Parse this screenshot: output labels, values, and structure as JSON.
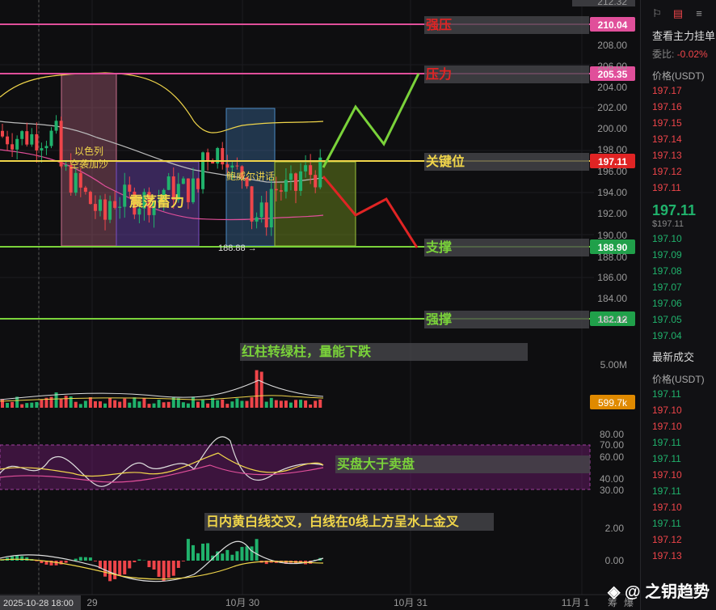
{
  "colors": {
    "bg": "#0e0e10",
    "up": "#20b26c",
    "down": "#ef454a",
    "pink": "#e04f9a",
    "yellow": "#f0d54a",
    "green": "#7ad23a",
    "red_line": "#e02424"
  },
  "price_axis": {
    "ticks": [
      "212.32",
      "208.00",
      "206.00",
      "204.00",
      "202.00",
      "200.00",
      "198.00",
      "196.00",
      "194.00",
      "192.00",
      "190.00",
      "188.00",
      "186.00",
      "184.00",
      "182.00"
    ],
    "badges": {
      "strong_resist": "210.04",
      "resist": "205.35",
      "key": "197.11",
      "support": "188.90",
      "strong_support": "182.12",
      "vol": "599.7k"
    }
  },
  "levels": {
    "strong_resist": "强压",
    "resist": "压力",
    "key": "关键位",
    "support": "支撑",
    "strong_support": "强撑"
  },
  "annotations": {
    "box1_line1": "以色列",
    "box1_line2": "空袭加沙",
    "box2": "震荡蓄力",
    "box3": "鲍威尔讲话",
    "low_label": "188.88 →",
    "volume_note": "红柱转绿柱，量能下跌",
    "rsi_note": "买盘大于卖盘",
    "macd_note": "日内黄白线交叉，白线在0线上方呈水上金叉"
  },
  "volume_axis": {
    "tick": "5.00M"
  },
  "rsi_axis": {
    "ticks": [
      "80.00",
      "70.00",
      "60.00",
      "40.00",
      "30.00"
    ]
  },
  "macd_axis": {
    "ticks": [
      "2.00",
      "0.00"
    ]
  },
  "time_axis": {
    "cursor": "2025-10-28 18:00",
    "labels": [
      "29",
      "10月 30",
      "10月 31",
      "11月 1"
    ],
    "right_tools": [
      "筹",
      "爆"
    ]
  },
  "side_panel": {
    "title": "查看主力挂单",
    "ratio_label": "委比:",
    "ratio_value": "-0.02%",
    "price_header": "价格(USDT)",
    "asks": [
      "197.17",
      "197.16",
      "197.15",
      "197.14",
      "197.13",
      "197.12",
      "197.11"
    ],
    "last_price": "197.11",
    "last_sub": "$197.11",
    "bids": [
      "197.10",
      "197.09",
      "197.08",
      "197.07",
      "197.06",
      "197.05",
      "197.04"
    ],
    "trades_title": "最新成交",
    "trades_header": "价格(USDT)",
    "trades": [
      {
        "p": "197.11",
        "d": "up"
      },
      {
        "p": "197.10",
        "d": "down"
      },
      {
        "p": "197.10",
        "d": "down"
      },
      {
        "p": "197.11",
        "d": "up"
      },
      {
        "p": "197.11",
        "d": "up"
      },
      {
        "p": "197.10",
        "d": "down"
      },
      {
        "p": "197.11",
        "d": "up"
      },
      {
        "p": "197.10",
        "d": "down"
      },
      {
        "p": "197.11",
        "d": "up"
      },
      {
        "p": "197.12",
        "d": "down"
      },
      {
        "p": "197.13",
        "d": "down"
      }
    ]
  },
  "watermark": "◈ @ 之钥趋势"
}
